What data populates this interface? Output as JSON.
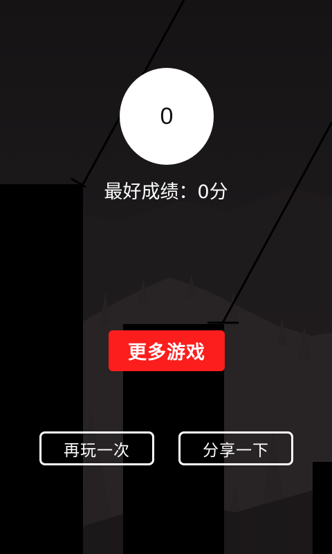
{
  "game": {
    "score": "0",
    "best_score_label": "最好成绩：",
    "best_score_value": "0分",
    "more_games_label": "更多游戏",
    "replay_label": "再玩一次",
    "share_label": "分享一下"
  },
  "colors": {
    "background": "#1a1819",
    "pillar": "#000000",
    "more_games_button": "#fc1d1d",
    "button_outline": "#ffffff",
    "score_circle": "#ffffff"
  }
}
